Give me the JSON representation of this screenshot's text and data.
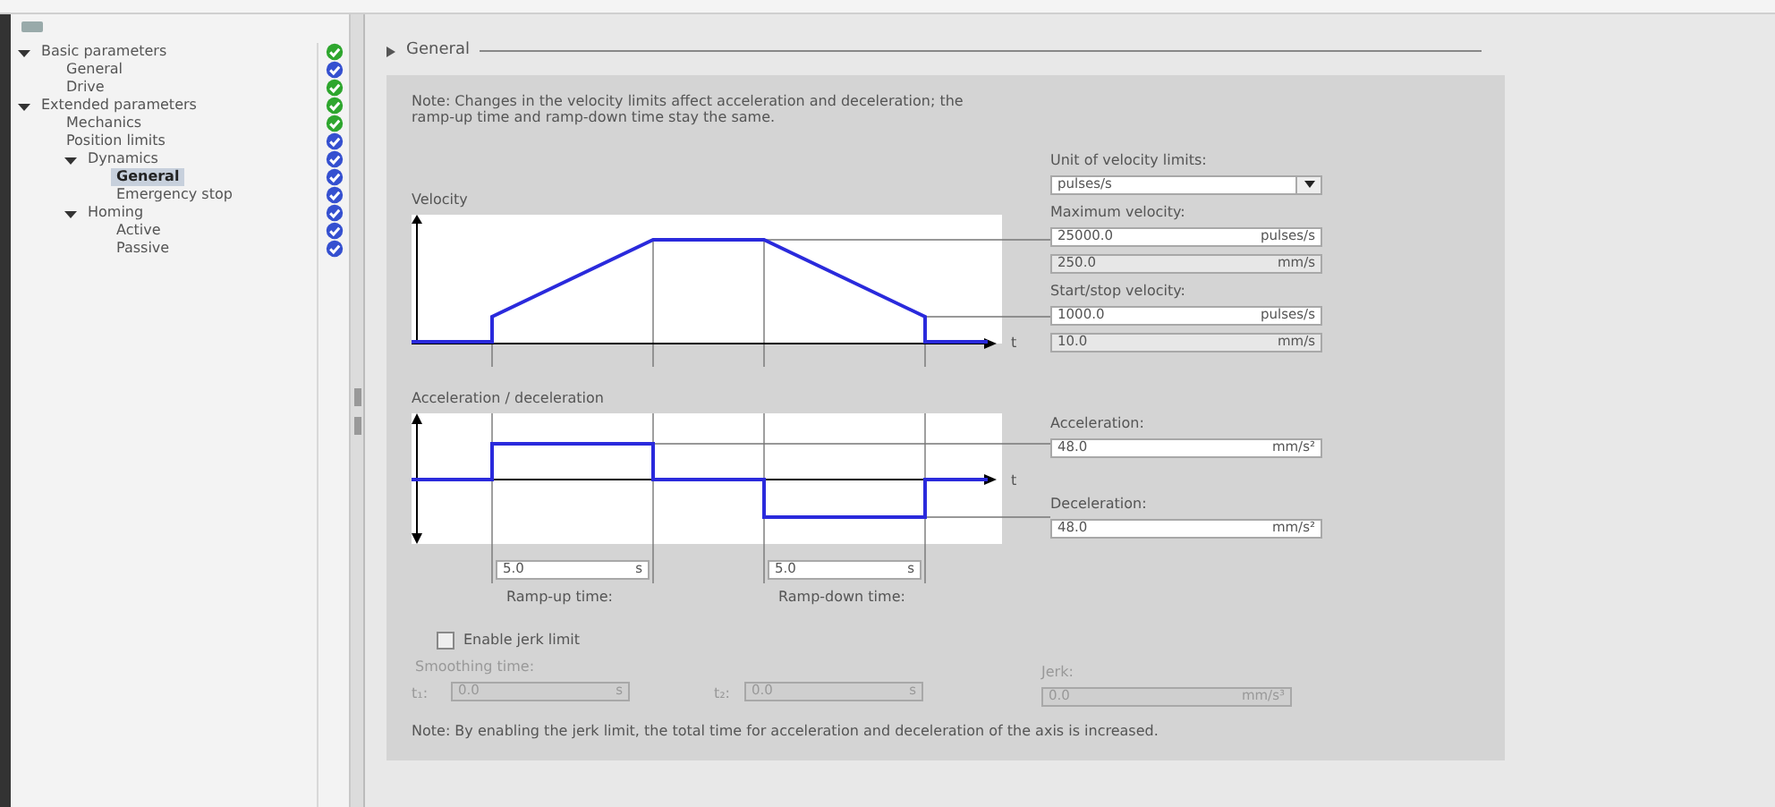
{
  "tree": [
    {
      "label": "Basic parameters",
      "expanded": true,
      "selected": false,
      "color": "#2ea62e",
      "children": [
        {
          "label": "General",
          "selected": false,
          "color": "#3550d0"
        },
        {
          "label": "Drive",
          "selected": false,
          "color": "#2ea62e"
        }
      ]
    },
    {
      "label": "Extended parameters",
      "expanded": true,
      "selected": false,
      "color": "#2ea62e",
      "children": [
        {
          "label": "Mechanics",
          "selected": false,
          "color": "#2ea62e"
        },
        {
          "label": "Position limits",
          "selected": false,
          "color": "#3550d0"
        },
        {
          "label": "Dynamics",
          "expanded": true,
          "selected": false,
          "color": "#3550d0",
          "children": [
            {
              "label": "General",
              "selected": true,
              "color": "#3550d0"
            },
            {
              "label": "Emergency stop",
              "selected": false,
              "color": "#3550d0"
            }
          ]
        },
        {
          "label": "Homing",
          "expanded": true,
          "selected": false,
          "color": "#3550d0",
          "children": [
            {
              "label": "Active",
              "selected": false,
              "color": "#3550d0"
            },
            {
              "label": "Passive",
              "selected": false,
              "color": "#3550d0"
            }
          ]
        }
      ]
    }
  ],
  "section": {
    "title": "General",
    "expanded": true
  },
  "note": "Note: Changes in the velocity limits affect acceleration and deceleration; the ramp-up time and ramp-down time stay the same.",
  "velocity": {
    "title": "Velocity",
    "axis_label": "t",
    "unit_label": "Unit of velocity limits:",
    "unit": "pulses/s",
    "groups": [
      {
        "label": "Maximum velocity:",
        "fields": [
          {
            "value": "25000.0",
            "unit": "pulses/s",
            "read_only": false
          },
          {
            "value": "250.0",
            "unit": "mm/s",
            "read_only": true
          }
        ]
      },
      {
        "label": "Start/stop velocity:",
        "fields": [
          {
            "value": "1000.0",
            "unit": "pulses/s",
            "read_only": false
          },
          {
            "value": "10.0",
            "unit": "mm/s",
            "read_only": true
          }
        ]
      }
    ]
  },
  "acceleration": {
    "title": "Acceleration / deceleration",
    "axis_label": "t",
    "groups": [
      {
        "label": "Acceleration:",
        "fields": [
          {
            "value": "48.0",
            "unit": "mm/s²",
            "read_only": false
          }
        ]
      },
      {
        "label": "Deceleration:",
        "fields": [
          {
            "value": "48.0",
            "unit": "mm/s²",
            "read_only": false
          }
        ]
      }
    ],
    "times": [
      {
        "value": "5.0",
        "unit": "s",
        "label": "Ramp-up time:"
      },
      {
        "value": "5.0",
        "unit": "s",
        "label": "Ramp-down time:"
      }
    ]
  },
  "jerk": {
    "label": "Enable jerk limit",
    "checked": false,
    "smoothing_label": "Smoothing time:",
    "times": [
      {
        "prefix": "t₁:",
        "value": "0.0",
        "unit": "s"
      },
      {
        "prefix": "t₂:",
        "value": "0.0",
        "unit": "s"
      }
    ],
    "jerk_label": "Jerk:",
    "jerk_value": "0.0",
    "jerk_unit": "mm/s³"
  },
  "footer_note": "Note: By enabling the jerk limit, the total time for acceleration and deceleration of the axis is increased."
}
